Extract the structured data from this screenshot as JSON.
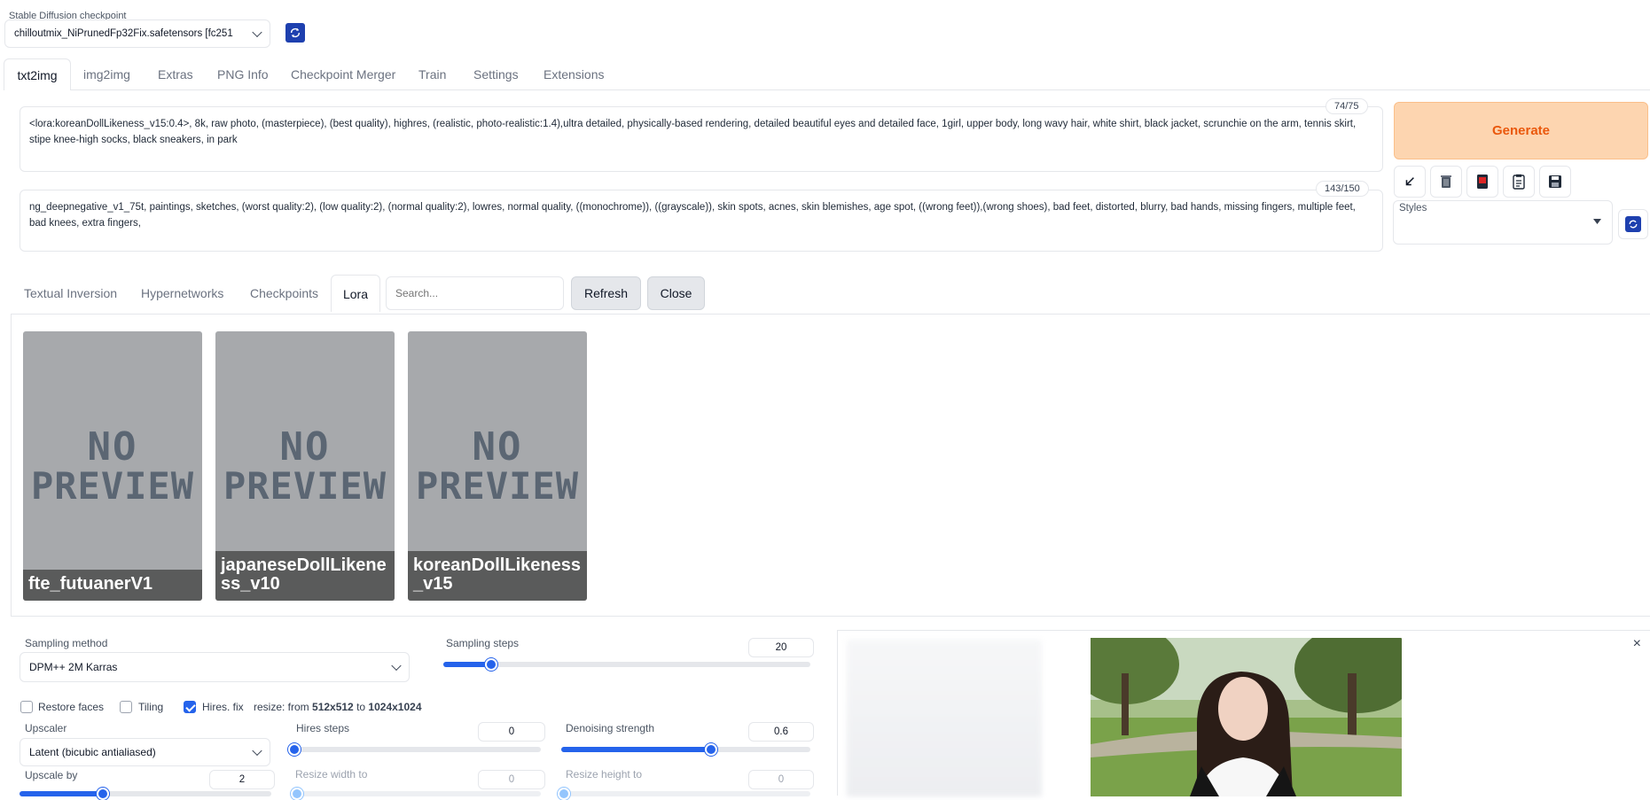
{
  "checkpoint": {
    "label": "Stable Diffusion checkpoint",
    "value": "chilloutmix_NiPrunedFp32Fix.safetensors [fc251"
  },
  "tabs": [
    "txt2img",
    "img2img",
    "Extras",
    "PNG Info",
    "Checkpoint Merger",
    "Train",
    "Settings",
    "Extensions"
  ],
  "prompt": {
    "text": "<lora:koreanDollLikeness_v15:0.4>, 8k, raw photo, (masterpiece), (best quality), highres, (realistic, photo-realistic:1.4),ultra detailed, physically-based rendering, detailed beautiful eyes and detailed face, 1girl, upper body, long wavy hair, white shirt, black jacket, scrunchie on the arm, tennis skirt, stipe knee-high socks, black sneakers, in park",
    "counter": "74/75"
  },
  "negative_prompt": {
    "text": "ng_deepnegative_v1_75t, paintings, sketches, (worst quality:2), (low quality:2), (normal quality:2), lowres, normal quality, ((monochrome)), ((grayscale)), skin spots, acnes, skin blemishes, age spot, ((wrong feet)),(wrong shoes), bad feet, distorted, blurry, bad hands, missing fingers, multiple feet, bad knees, extra fingers,",
    "counter": "143/150"
  },
  "generate_label": "Generate",
  "tool_icons": [
    "arrow-icon",
    "trash-icon",
    "card-icon",
    "clipboard-icon",
    "save-icon"
  ],
  "styles_label": "Styles",
  "network_tabs": [
    "Textual Inversion",
    "Hypernetworks",
    "Checkpoints",
    "Lora"
  ],
  "search_placeholder": "Search...",
  "refresh_label": "Refresh",
  "close_label": "Close",
  "no_preview": [
    "NO",
    "PREVIEW"
  ],
  "lora_cards": [
    "fte_futuanerV1",
    "japaneseDollLikeness_v10",
    "koreanDollLikeness_v15"
  ],
  "sampling": {
    "method_label": "Sampling method",
    "method_value": "DPM++ 2M Karras",
    "steps_label": "Sampling steps",
    "steps_value": "20",
    "steps_fraction": 0.13
  },
  "checkboxes": {
    "restore_faces": "Restore faces",
    "tiling": "Tiling",
    "hires_fix": "Hires. fix",
    "hires_checked": true
  },
  "resize_info": {
    "prefix": "resize: from ",
    "from": "512x512",
    "mid": " to ",
    "to": "1024x1024"
  },
  "upscaler": {
    "label": "Upscaler",
    "value": "Latent (bicubic antialiased)"
  },
  "hires_steps": {
    "label": "Hires steps",
    "value": "0",
    "fraction": 0
  },
  "denoising": {
    "label": "Denoising strength",
    "value": "0.6",
    "fraction": 0.6
  },
  "upscale_by": {
    "label": "Upscale by",
    "value": "2",
    "fraction": 0.33
  },
  "resize_width": {
    "label": "Resize width to",
    "value": "0"
  },
  "resize_height": {
    "label": "Resize height to",
    "value": "0"
  },
  "output_close": "×",
  "colors": {
    "accent": "#2563eb",
    "generate_bg": "#fdd5b0",
    "generate_text": "#ea580c"
  }
}
